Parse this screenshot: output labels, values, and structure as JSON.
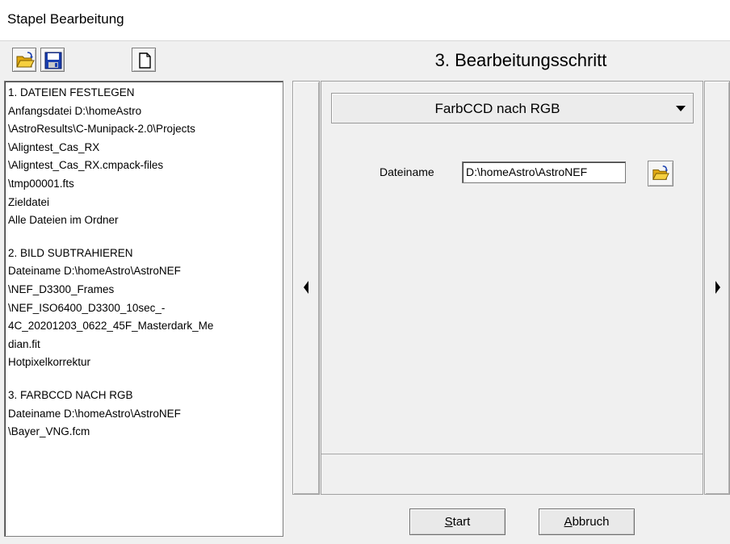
{
  "window": {
    "title": "Stapel Bearbeitung"
  },
  "toolbar": {
    "open": {
      "icon": "open-folder-icon"
    },
    "save": {
      "icon": "save-floppy-icon"
    },
    "new": {
      "icon": "new-document-icon"
    }
  },
  "step": {
    "title": "3. Bearbeitungsschritt"
  },
  "summary": {
    "lines": [
      "1. DATEIEN FESTLEGEN",
      "Anfangsdatei   D:\\homeAstro",
      "\\AstroResults\\C-Munipack-2.0\\Projects",
      "\\Aligntest_Cas_RX",
      "\\Aligntest_Cas_RX.cmpack-files",
      "\\tmp00001.fts",
      "Zieldatei",
      "Alle Dateien im Ordner",
      "",
      "2. BILD SUBTRAHIEREN",
      "Dateiname   D:\\homeAstro\\AstroNEF",
      "\\NEF_D3300_Frames",
      "\\NEF_ISO6400_D3300_10sec_-",
      "4C_20201203_0622_45F_Masterdark_Me",
      "dian.fit",
      "Hotpixelkorrektur",
      "",
      "3. FARBCCD NACH RGB",
      "Dateiname   D:\\homeAstro\\AstroNEF",
      "\\Bayer_VNG.fcm"
    ]
  },
  "nav": {
    "prev_icon": "arrow-left-icon",
    "next_icon": "arrow-right-icon"
  },
  "operation": {
    "selected": "FarbCCD nach RGB"
  },
  "file_field": {
    "label": "Dateiname",
    "value": "D:\\homeAstro\\AstroNEF"
  },
  "buttons": {
    "start": {
      "accel": "S",
      "rest": "tart"
    },
    "abort": {
      "accel": "A",
      "rest": "bbruch"
    }
  },
  "colors": {
    "window_bg": "#f0f0f0",
    "panel_bg": "#ffffff",
    "folder_yellow": "#f0c020",
    "floppy_blue": "#1a3fb0"
  }
}
